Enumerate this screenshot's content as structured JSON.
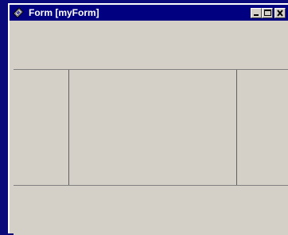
{
  "window": {
    "title": "Form [myForm]"
  },
  "titlebar": {
    "icon": "form-app-icon",
    "buttons": {
      "minimize_icon": "minimize-icon",
      "maximize_icon": "maximize-icon",
      "close_icon": "close-icon"
    }
  },
  "colors": {
    "desktop": "#0a0a7a",
    "titlebar": "#000080",
    "face": "#d4d0c8",
    "border": "#808080"
  }
}
